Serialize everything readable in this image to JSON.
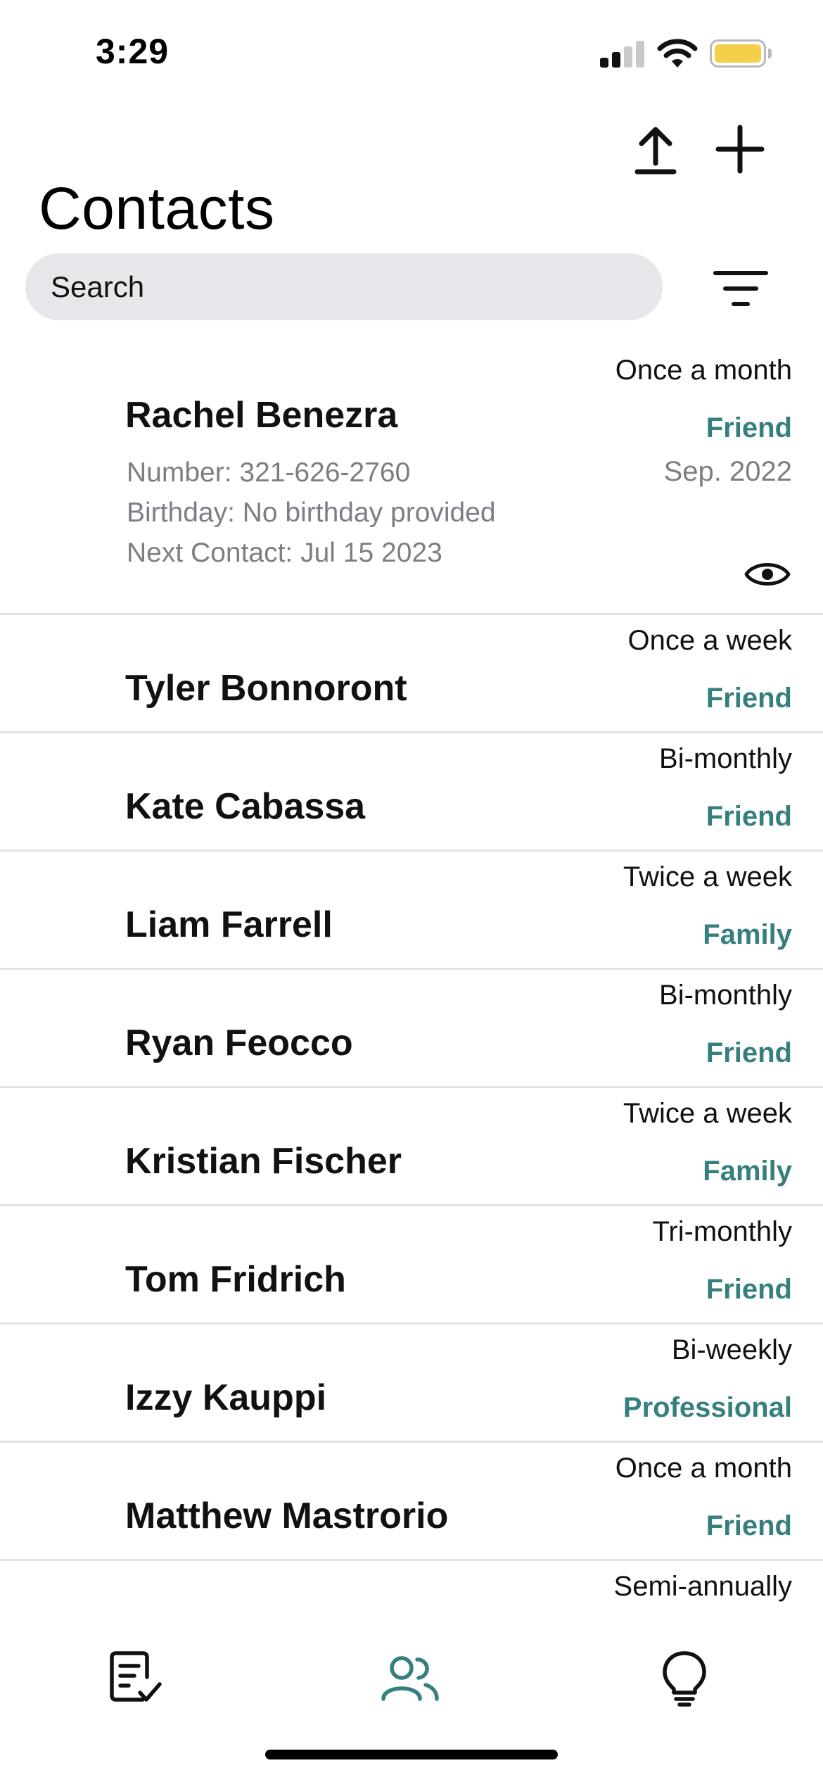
{
  "status_bar": {
    "time": "3:29",
    "icons": [
      "cellular-signal-icon",
      "wifi-icon",
      "battery-icon"
    ],
    "battery_color": "#f4cf4a"
  },
  "header": {
    "title": "Contacts",
    "actions": [
      "upload-icon",
      "plus-icon"
    ]
  },
  "search": {
    "placeholder": "Search",
    "filter_icon": "filter-icon"
  },
  "accent_color": "#357f7e",
  "contacts": [
    {
      "name": "Rachel Benezra",
      "frequency": "Once a month",
      "category": "Friend",
      "since": "Sep. 2022",
      "number": "Number: 321-626-2760",
      "birthday": "Birthday: No birthday provided",
      "next_contact": "Next Contact: Jul 15 2023",
      "expanded": true,
      "view_icon": "eye-icon"
    },
    {
      "name": "Tyler Bonnoront",
      "frequency": "Once a week",
      "category": "Friend"
    },
    {
      "name": "Kate Cabassa",
      "frequency": "Bi-monthly",
      "category": "Friend"
    },
    {
      "name": "Liam Farrell",
      "frequency": "Twice a week",
      "category": "Family"
    },
    {
      "name": "Ryan Feocco",
      "frequency": "Bi-monthly",
      "category": "Friend"
    },
    {
      "name": "Kristian Fischer",
      "frequency": "Twice a week",
      "category": "Family"
    },
    {
      "name": "Tom Fridrich",
      "frequency": "Tri-monthly",
      "category": "Friend"
    },
    {
      "name": "Izzy Kauppi",
      "frequency": "Bi-weekly",
      "category": "Professional"
    },
    {
      "name": "Matthew Mastrorio",
      "frequency": "Once a month",
      "category": "Friend"
    },
    {
      "name": "",
      "frequency": "Semi-annually",
      "category": ""
    }
  ],
  "tab_bar": {
    "tabs": [
      {
        "icon": "checklist-icon",
        "active": false
      },
      {
        "icon": "people-icon",
        "active": true
      },
      {
        "icon": "lightbulb-icon",
        "active": false
      }
    ]
  }
}
